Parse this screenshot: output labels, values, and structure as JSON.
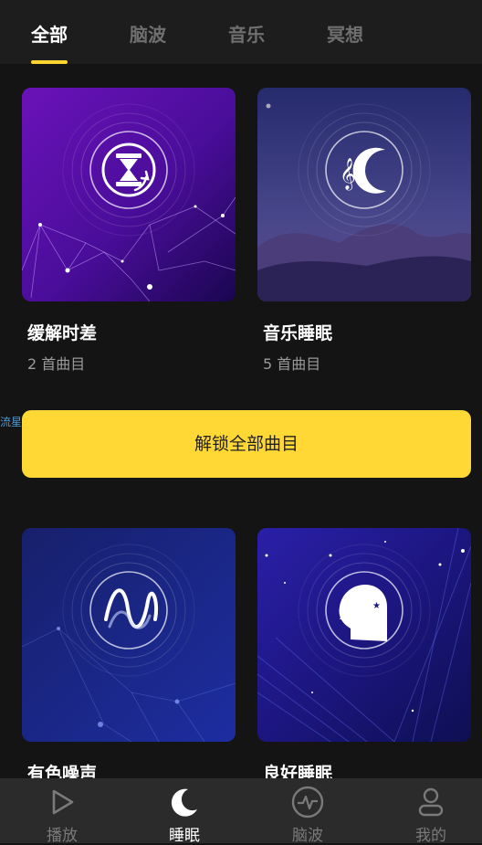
{
  "tabs": [
    {
      "label": "全部",
      "active": true
    },
    {
      "label": "脑波",
      "active": false
    },
    {
      "label": "音乐",
      "active": false
    },
    {
      "label": "冥想",
      "active": false
    }
  ],
  "cards": [
    {
      "title": "缓解时差",
      "subtitle": "2 首曲目",
      "icon": "hourglass-refresh-icon"
    },
    {
      "title": "音乐睡眠",
      "subtitle": "5 首曲目",
      "icon": "music-moon-icon"
    },
    {
      "title": "有色噪声",
      "subtitle": "",
      "icon": "sound-wave-icon"
    },
    {
      "title": "良好睡眠",
      "subtitle": "",
      "icon": "head-moon-icon"
    }
  ],
  "unlock_button": {
    "label": "解锁全部曲目"
  },
  "watermark": "流星社区",
  "bottom_nav": [
    {
      "label": "播放",
      "icon": "play-icon",
      "active": false
    },
    {
      "label": "睡眠",
      "icon": "moon-icon",
      "active": true
    },
    {
      "label": "脑波",
      "icon": "pulse-icon",
      "active": false
    },
    {
      "label": "我的",
      "icon": "user-icon",
      "active": false
    }
  ],
  "colors": {
    "accent": "#ffd836",
    "background": "#141414"
  }
}
